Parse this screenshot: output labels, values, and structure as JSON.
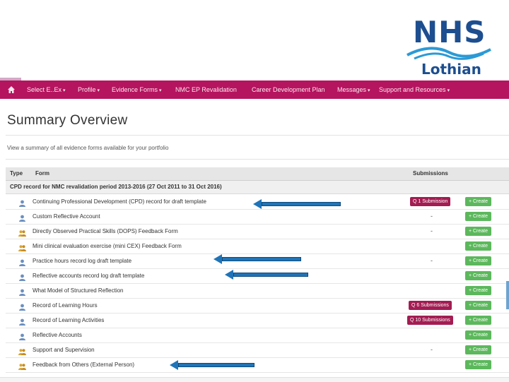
{
  "logo": {
    "top": "NHS",
    "bottom": "Lothian"
  },
  "nav": {
    "items": [
      {
        "label": "Select E..Ex",
        "caret": "▾"
      },
      {
        "label": "Profile",
        "caret": "▾"
      },
      {
        "label": "Evidence Forms",
        "caret": "▾"
      },
      {
        "label": "NMC EP Revalidation",
        "caret": ""
      },
      {
        "label": "Career Development Plan",
        "caret": ""
      },
      {
        "label": "Messages",
        "caret": "▾"
      },
      {
        "label": "Support and Resources",
        "caret": "▾"
      }
    ]
  },
  "page": {
    "title": "Summary Overview",
    "subtitle": "View a summary of all evidence forms available for your portfolio"
  },
  "table": {
    "headers": {
      "type": "Type",
      "form": "Form",
      "submissions": "Submissions"
    },
    "group": "CPD record for NMC revalidation period 2013-2016 (27 Oct 2011 to 31 Oct 2016)",
    "create_label": "+ Create",
    "rows": [
      {
        "name": "Continuing Professional Development (CPD) record for draft template",
        "icon": "person-icon",
        "sub": "Q 1 Submission",
        "dash": ""
      },
      {
        "name": "Custom Reflective Account",
        "icon": "person-icon",
        "sub": "",
        "dash": "-"
      },
      {
        "name": "Directly Observed Practical Skills (DOPS) Feedback Form",
        "icon": "group-icon",
        "sub": "",
        "dash": "-"
      },
      {
        "name": "Mini clinical evaluation exercise (mini CEX) Feedback Form",
        "icon": "group-icon",
        "sub": "",
        "dash": ""
      },
      {
        "name": "Practice hours record log draft template",
        "icon": "person-icon",
        "sub": "",
        "dash": "-"
      },
      {
        "name": "Reflective accounts record log draft template",
        "icon": "person-icon",
        "sub": "",
        "dash": ""
      },
      {
        "name": "What Model of Structured Reflection",
        "icon": "person-icon",
        "sub": "",
        "dash": ""
      },
      {
        "name": "Record of Learning Hours",
        "icon": "person-icon",
        "sub": "Q 6 Submissions",
        "dash": ""
      },
      {
        "name": "Record of Learning Activities",
        "icon": "person-icon",
        "sub": "Q 10 Submissions",
        "dash": ""
      },
      {
        "name": "Reflective Accounts",
        "icon": "person-icon",
        "sub": "",
        "dash": ""
      },
      {
        "name": "Support and Supervision",
        "icon": "group-icon",
        "sub": "",
        "dash": "-"
      },
      {
        "name": "Feedback from Others (External Person)",
        "icon": "group-icon",
        "sub": "",
        "dash": ""
      }
    ]
  },
  "colors": {
    "navbar": "#b5145f",
    "submission": "#a31c52",
    "create": "#5cb85c",
    "arrow": "#1f74b8",
    "nhs_blue": "#1d4e8f"
  }
}
